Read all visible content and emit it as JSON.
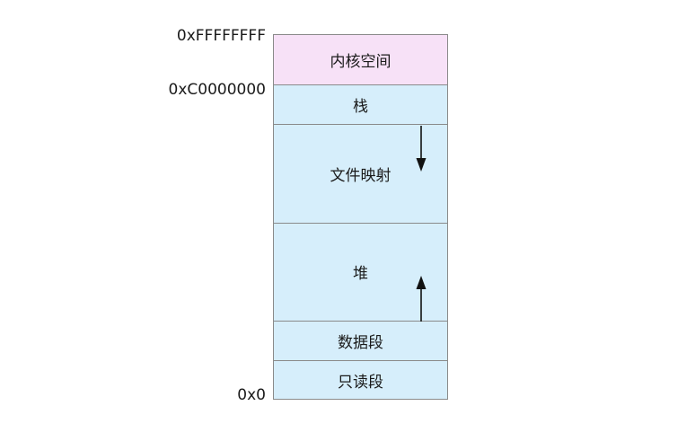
{
  "addresses": {
    "top": "0xFFFFFFFF",
    "kernel_start": "0xC0000000",
    "zero": "0x0"
  },
  "segments": {
    "kernel": "内核空间",
    "stack": "栈",
    "mmap": "文件映射",
    "heap": "堆",
    "data": "数据段",
    "readonly": "只读段"
  },
  "colors": {
    "kernel_fill": "#f7e1f7",
    "user_fill": "#d6eefb",
    "border": "#8a8a8a"
  }
}
